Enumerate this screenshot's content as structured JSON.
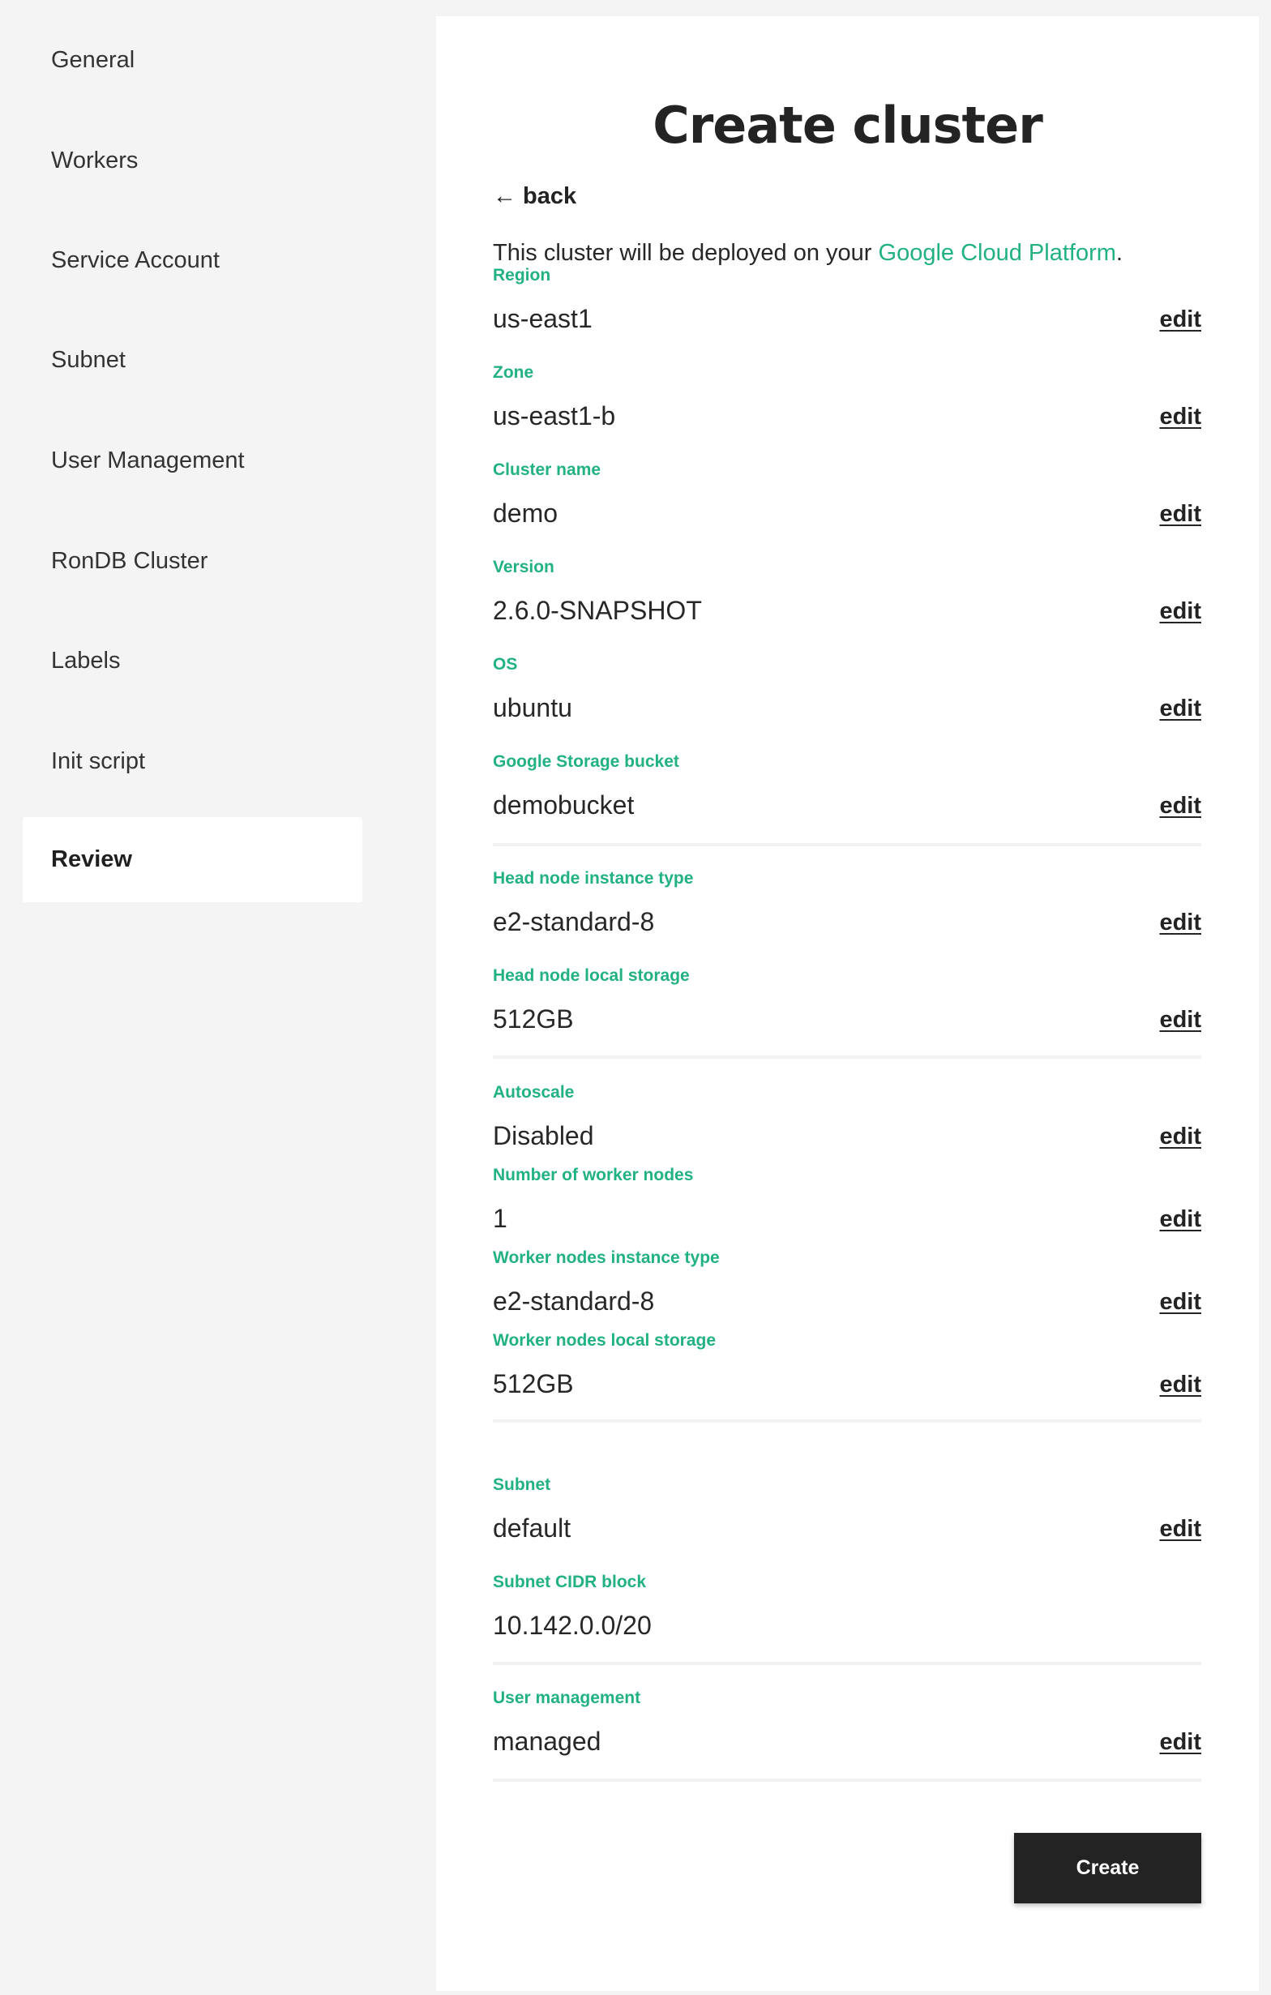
{
  "sidebar": {
    "items": [
      {
        "label": "General",
        "active": false
      },
      {
        "label": "Workers",
        "active": false
      },
      {
        "label": "Service Account",
        "active": false
      },
      {
        "label": "Subnet",
        "active": false
      },
      {
        "label": "User Management",
        "active": false
      },
      {
        "label": "RonDB Cluster",
        "active": false
      },
      {
        "label": "Labels",
        "active": false
      },
      {
        "label": "Init script",
        "active": false
      },
      {
        "label": "Review",
        "active": true
      }
    ]
  },
  "main": {
    "title": "Create cluster",
    "back_label": "← back",
    "intro_text": "This cluster will be deployed on your ",
    "intro_link": "Google Cloud Platform",
    "intro_end": ".",
    "edit_label": "edit",
    "accent_color": "#21b182",
    "fields": [
      {
        "label": "Region",
        "value": "us-east1",
        "editable": true
      },
      {
        "label": "Zone",
        "value": "us-east1-b",
        "editable": true
      },
      {
        "label": "Cluster name",
        "value": "demo",
        "editable": true
      },
      {
        "label": "Version",
        "value": "2.6.0-SNAPSHOT",
        "editable": true
      },
      {
        "label": "OS",
        "value": "ubuntu",
        "editable": true
      },
      {
        "label": "Google Storage bucket",
        "value": "demobucket",
        "editable": true
      },
      {
        "label": "Head node instance type",
        "value": "e2-standard-8",
        "editable": true
      },
      {
        "label": "Head node local storage",
        "value": "512GB",
        "editable": true
      },
      {
        "label": "Autoscale",
        "value": "Disabled",
        "editable": true
      },
      {
        "label": "Number of worker nodes",
        "value": "1",
        "editable": true
      },
      {
        "label": "Worker nodes instance type",
        "value": "e2-standard-8",
        "editable": true
      },
      {
        "label": "Worker nodes local storage",
        "value": "512GB",
        "editable": true
      },
      {
        "label": "Subnet",
        "value": "default",
        "editable": true
      },
      {
        "label": "Subnet CIDR block",
        "value": "10.142.0.0/20",
        "editable": false
      },
      {
        "label": "User management",
        "value": "managed",
        "editable": true
      }
    ],
    "create_label": "Create"
  }
}
